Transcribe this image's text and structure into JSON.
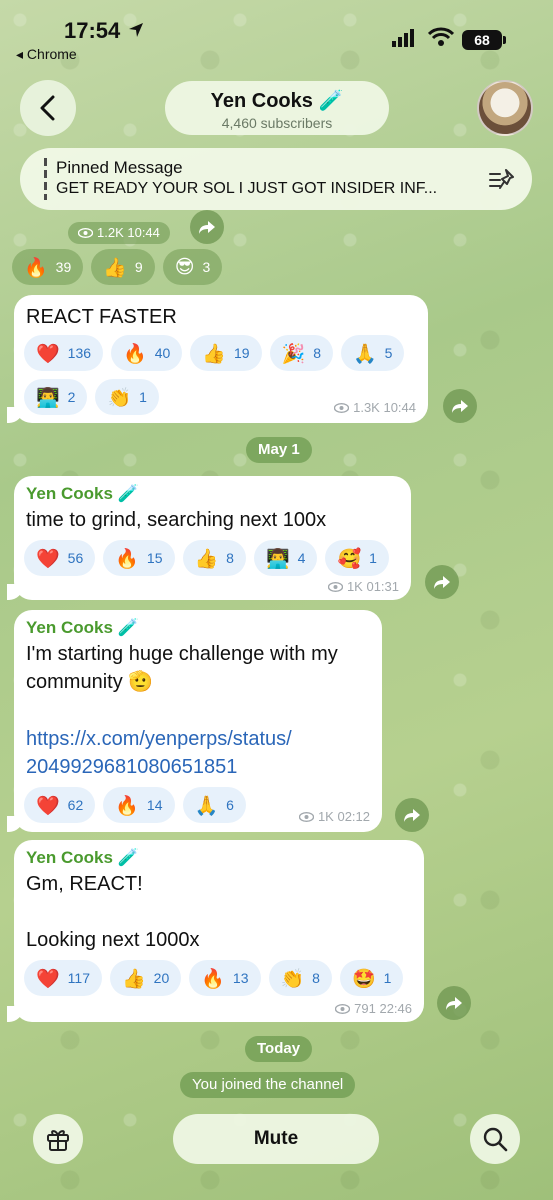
{
  "status": {
    "time": "17:54",
    "back_app": "◂ Chrome",
    "battery": "68"
  },
  "header": {
    "title": "Yen Cooks 🧪",
    "subtitle": "4,460 subscribers"
  },
  "pinned": {
    "title": "Pinned Message",
    "text": "GET READY YOUR SOL I JUST GOT INSIDER INF..."
  },
  "top_meta": {
    "views": "1.2K 10:44"
  },
  "top_reactions": [
    {
      "emoji": "🔥",
      "count": "39"
    },
    {
      "emoji": "👍",
      "count": "9"
    },
    {
      "emoji": "😎",
      "count": "3"
    }
  ],
  "messages": [
    {
      "author": "",
      "text": "REACT FASTER",
      "link": "",
      "reactions": [
        {
          "emoji": "❤️",
          "count": "136"
        },
        {
          "emoji": "🔥",
          "count": "40"
        },
        {
          "emoji": "👍",
          "count": "19"
        },
        {
          "emoji": "🎉",
          "count": "8"
        },
        {
          "emoji": "🙏",
          "count": "5"
        },
        {
          "emoji": "👨‍💻",
          "count": "2"
        },
        {
          "emoji": "👏",
          "count": "1"
        }
      ],
      "meta": "1.3K 10:44"
    },
    {
      "author": "Yen Cooks 🧪",
      "text": "time to grind, searching next 100x",
      "link": "",
      "reactions": [
        {
          "emoji": "❤️",
          "count": "56"
        },
        {
          "emoji": "🔥",
          "count": "15"
        },
        {
          "emoji": "👍",
          "count": "8"
        },
        {
          "emoji": "👨‍💻",
          "count": "4"
        },
        {
          "emoji": "🥰",
          "count": "1"
        }
      ],
      "meta": "1K 01:31"
    },
    {
      "author": "Yen Cooks 🧪",
      "text": "I'm starting huge challenge with my community 🫡",
      "link_line1": "https://x.com/yenperps/status/",
      "link_line2": "2049929681080651851",
      "reactions": [
        {
          "emoji": "❤️",
          "count": "62"
        },
        {
          "emoji": "🔥",
          "count": "14"
        },
        {
          "emoji": "🙏",
          "count": "6"
        }
      ],
      "meta": "1K 02:12"
    },
    {
      "author": "Yen Cooks 🧪",
      "text": "Gm, REACT!\n\nLooking next 1000x",
      "link": "",
      "reactions": [
        {
          "emoji": "❤️",
          "count": "117"
        },
        {
          "emoji": "👍",
          "count": "20"
        },
        {
          "emoji": "🔥",
          "count": "13"
        },
        {
          "emoji": "👏",
          "count": "8"
        },
        {
          "emoji": "🤩",
          "count": "1"
        }
      ],
      "meta": "791 22:46"
    }
  ],
  "dates": {
    "may": "May 1",
    "today": "Today"
  },
  "service": "You joined the channel",
  "bottom": {
    "mute": "Mute"
  },
  "colors": {
    "author": "#4a9a2e",
    "link": "#2a66b8",
    "reaction_bg": "#e7f1fb",
    "reaction_text": "#2f74c0"
  },
  "icons": [
    "location-arrow-icon",
    "signal-icon",
    "wifi-icon",
    "chevron-left-icon",
    "pin-icon",
    "eye-icon",
    "share-icon",
    "gift-icon",
    "search-icon"
  ]
}
